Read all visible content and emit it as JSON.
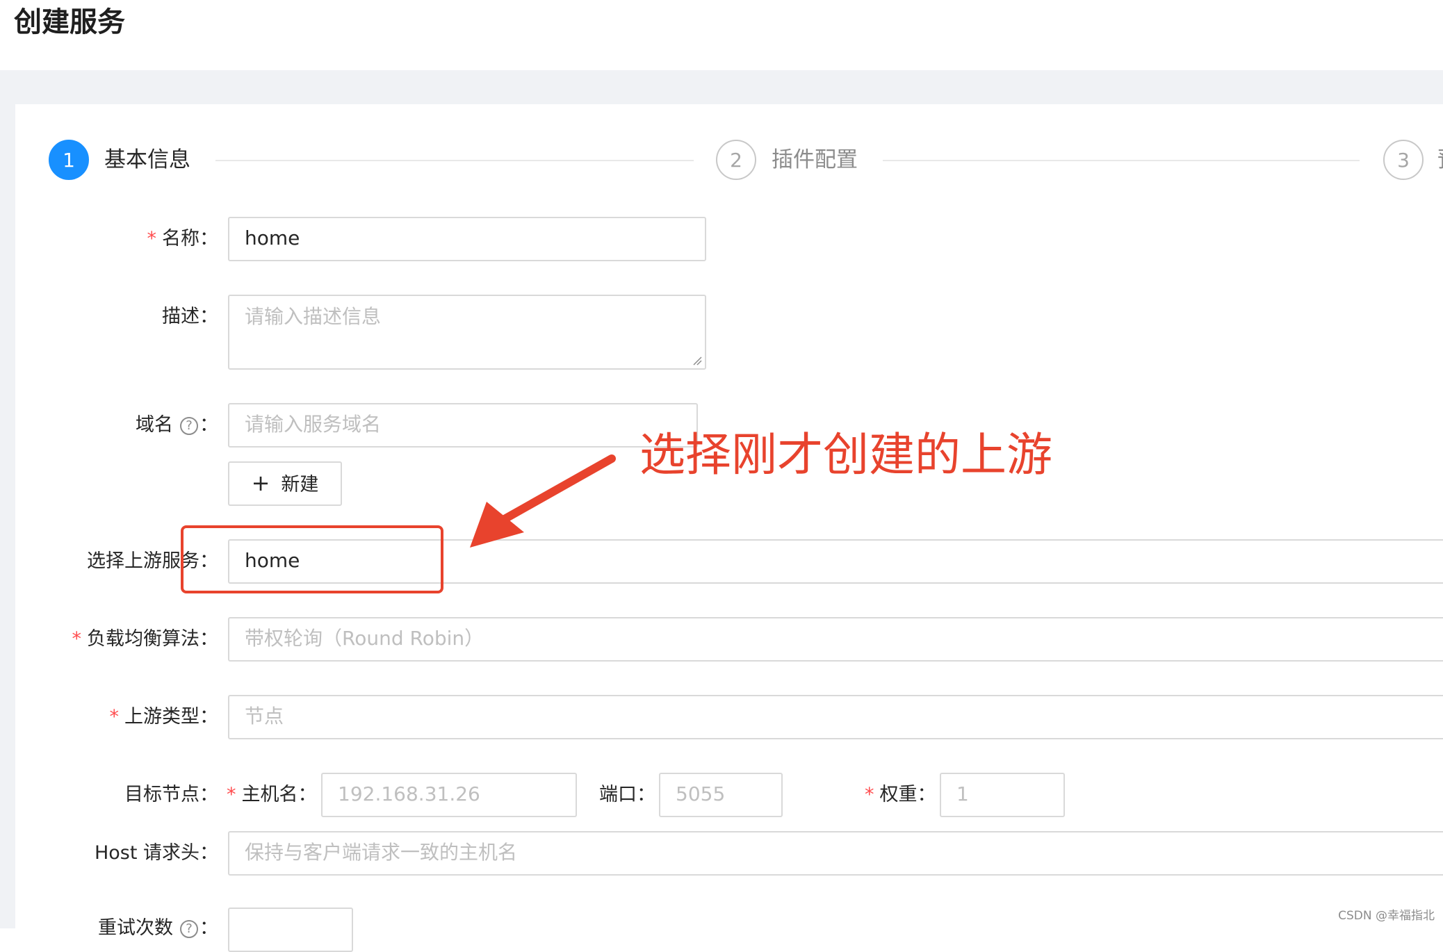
{
  "page": {
    "title": "创建服务"
  },
  "steps": [
    {
      "number": "1",
      "label": "基本信息",
      "status": "active"
    },
    {
      "number": "2",
      "label": "插件配置",
      "status": "wait"
    },
    {
      "number": "3",
      "label": "预",
      "status": "wait"
    }
  ],
  "form": {
    "name": {
      "label": "名称",
      "required": "*",
      "value": "home"
    },
    "description": {
      "label": "描述",
      "placeholder": "请输入描述信息"
    },
    "domain": {
      "label": "域名",
      "help": "?",
      "placeholder": "请输入服务域名"
    },
    "new_button": {
      "icon": "plus-icon",
      "label": "新建"
    },
    "upstream": {
      "label": "选择上游服务",
      "value": "home"
    },
    "lb": {
      "label": "负载均衡算法",
      "required": "*",
      "placeholder": "带权轮询（Round Robin）"
    },
    "upstream_type": {
      "label": "上游类型",
      "required": "*",
      "placeholder": "节点"
    },
    "target": {
      "label": "目标节点",
      "host": {
        "label": "主机名",
        "required": "*",
        "placeholder": "192.168.31.26"
      },
      "port": {
        "label": "端口",
        "placeholder": "5055"
      },
      "weight": {
        "label": "权重",
        "required": "*",
        "placeholder": "1"
      }
    },
    "host_header": {
      "label": "Host 请求头",
      "placeholder": "保持与客户端请求一致的主机名"
    },
    "retries": {
      "label": "重试次数",
      "help": "?"
    },
    "colon": "："
  },
  "annotation": {
    "text": "选择刚才创建的上游",
    "color": "#e8432d"
  },
  "watermark": "CSDN @幸福指北",
  "colors": {
    "primary": "#1890ff",
    "required": "#ff4d4f",
    "annotation": "#e8432d",
    "background": "#f0f2f5"
  }
}
